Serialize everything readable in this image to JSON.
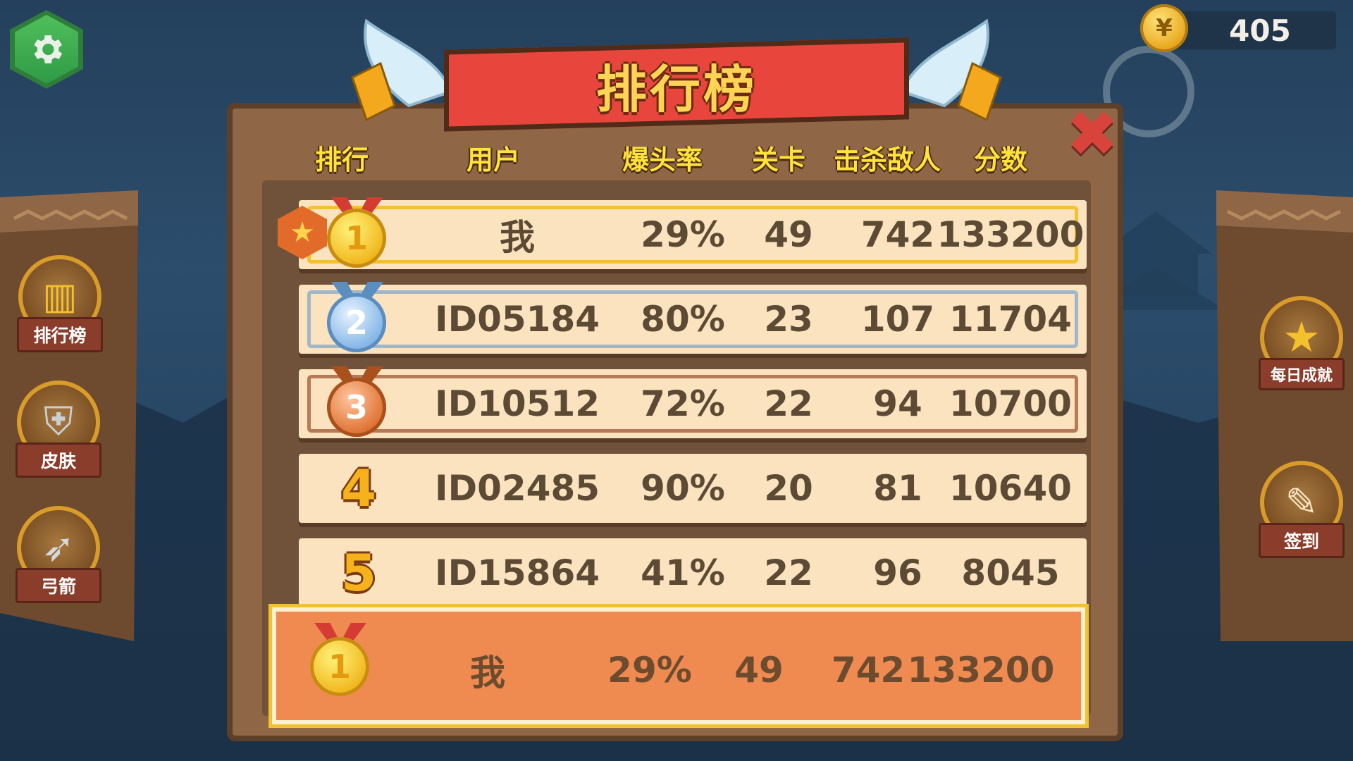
{
  "title": "排行榜",
  "coins": "405",
  "columns": [
    "排行",
    "用户",
    "爆头率",
    "关卡",
    "击杀敌人",
    "分数"
  ],
  "rows": [
    {
      "rank": "1",
      "user": "我",
      "headshot_rate": "29%",
      "level": "49",
      "kills": "742",
      "score": "133200",
      "medal": "gold"
    },
    {
      "rank": "2",
      "user": "ID05184",
      "headshot_rate": "80%",
      "level": "23",
      "kills": "107",
      "score": "11704",
      "medal": "silver"
    },
    {
      "rank": "3",
      "user": "ID10512",
      "headshot_rate": "72%",
      "level": "22",
      "kills": "94",
      "score": "10700",
      "medal": "bronze"
    },
    {
      "rank": "4",
      "user": "ID02485",
      "headshot_rate": "90%",
      "level": "20",
      "kills": "81",
      "score": "10640",
      "medal": "none"
    },
    {
      "rank": "5",
      "user": "ID15864",
      "headshot_rate": "41%",
      "level": "22",
      "kills": "96",
      "score": "8045",
      "medal": "none"
    }
  ],
  "my_entry": {
    "rank": "1",
    "user": "我",
    "headshot_rate": "29%",
    "level": "49",
    "kills": "742",
    "score": "133200"
  },
  "left_menu": [
    {
      "label": "排行榜",
      "icon": "podium-icon"
    },
    {
      "label": "皮肤",
      "icon": "armor-icon"
    },
    {
      "label": "弓箭",
      "icon": "bow-icon"
    }
  ],
  "right_menu": [
    {
      "label": "每日成就",
      "icon": "achievement-star-icon"
    },
    {
      "label": "签到",
      "icon": "clipboard-icon"
    }
  ],
  "colors": {
    "title_ribbon": "#e8463d",
    "title_text": "#ffd455",
    "header_text": "#ffe23a",
    "row_bg": "#fbe3bf",
    "my_row_bg": "#ef8b51",
    "panel": "#8f6646"
  }
}
